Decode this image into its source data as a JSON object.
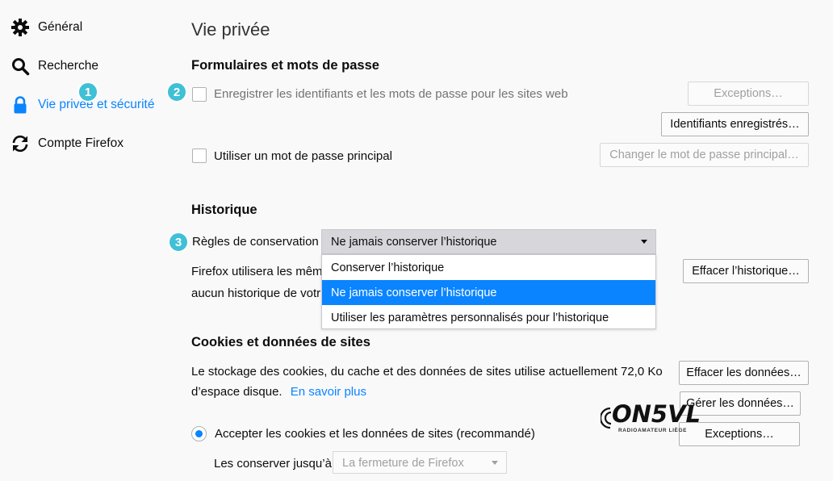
{
  "sidebar": {
    "items": [
      {
        "label": "Général",
        "icon": "gear-icon"
      },
      {
        "label": "Recherche",
        "icon": "search-icon"
      },
      {
        "label": "Vie privée et sécurité",
        "icon": "lock-icon",
        "active": true
      },
      {
        "label": "Compte Firefox",
        "icon": "sync-icon"
      }
    ]
  },
  "page": {
    "title": "Vie privée"
  },
  "forms": {
    "heading": "Formulaires et mots de passe",
    "save_logins_label": "Enregistrer les identifiants et les mots de passe pour les sites web",
    "save_logins_checked": false,
    "exceptions_button": "Exceptions…",
    "saved_logins_button": "Identifiants enregistrés…",
    "master_password_label": "Utiliser un mot de passe principal",
    "master_password_checked": false,
    "change_master_button": "Changer le mot de passe principal…"
  },
  "history": {
    "heading": "Historique",
    "rules_label": "Règles de conservation",
    "selected": "Ne jamais conserver l’historique",
    "options": [
      "Conserver l’historique",
      "Ne jamais conserver l’historique",
      "Utiliser les paramètres personnalisés pour l’historique"
    ],
    "selected_index": 1,
    "description_line1": "Firefox utilisera les mêm",
    "description_line2": "aucun historique de votr",
    "clear_history_button": "Effacer l’historique…"
  },
  "cookies": {
    "heading": "Cookies et données de sites",
    "description_line1": "Le stockage des cookies, du cache et des données de sites utilise actuellement 72,0 Ko",
    "description_line2": "d’espace disque.",
    "learn_more": "En savoir plus",
    "clear_data_button": "Effacer les données…",
    "manage_data_button": "Gérer les données…",
    "exceptions_button": "Exceptions…",
    "accept_label": "Accepter les cookies et les données de sites (recommandé)",
    "accept_selected": true,
    "keep_until_label": "Les conserver jusqu’à",
    "keep_until_value": "La fermeture de Firefox"
  },
  "badges": [
    "1",
    "2",
    "3"
  ],
  "watermark": {
    "main": "ON5VL",
    "sub": "RADIOAMATEUR LIÈGE"
  },
  "colors": {
    "accent": "#0a84ff",
    "badge": "#3fc0d6",
    "background": "#f9f9fa"
  }
}
